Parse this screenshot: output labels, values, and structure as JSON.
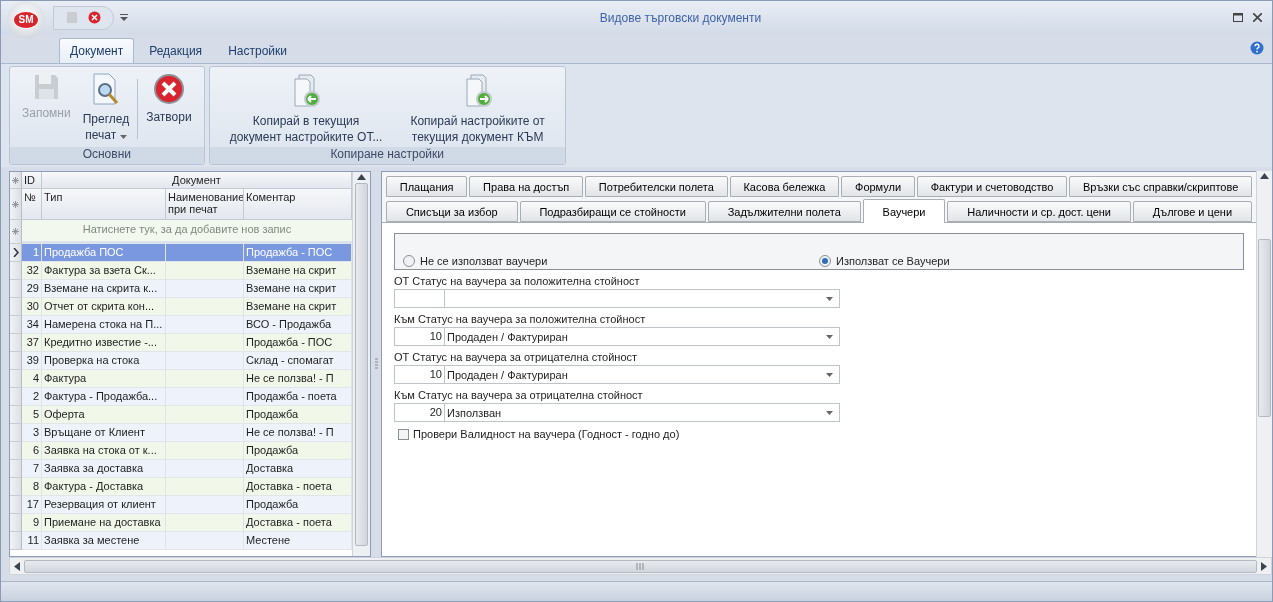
{
  "window": {
    "title": "Видове търговски документи",
    "logo": "SM"
  },
  "ribbon": {
    "tabs": [
      {
        "label": "Документ",
        "selected": true
      },
      {
        "label": "Редакция",
        "selected": false
      },
      {
        "label": "Настройки",
        "selected": false
      }
    ],
    "groups": [
      {
        "title": "Основни",
        "buttons": [
          {
            "label": "Запомни",
            "kind": "save",
            "disabled": true,
            "dropdown": false
          },
          {
            "label": "Преглед\nпечат",
            "kind": "preview",
            "disabled": false,
            "dropdown": true
          },
          {
            "label": "Затвори",
            "kind": "close",
            "disabled": false,
            "dropdown": false
          }
        ]
      },
      {
        "title": "Копиране настройки",
        "buttons": [
          {
            "label": "Копирай в текущия\nдокумент настройките ОТ...",
            "kind": "copy_in",
            "disabled": false,
            "dropdown": false
          },
          {
            "label": "Копирай настройките от\nтекущия документ КЪМ",
            "kind": "copy_out",
            "disabled": false,
            "dropdown": false
          }
        ]
      }
    ]
  },
  "grid": {
    "band": {
      "id": "ID",
      "document": "Документ"
    },
    "columns": [
      "№",
      "Тип",
      "Наименование\nпри печат",
      "Коментар"
    ],
    "new_row_hint": "Натиснете тук, за да добавите нов запис",
    "rows": [
      {
        "id": "1",
        "type": "Продажба ПОС",
        "comment": "Продажба - ПОС",
        "selected": true
      },
      {
        "id": "32",
        "type": "Фактура за взета Ск...",
        "comment": "Вземане на скрит",
        "selected": false
      },
      {
        "id": "29",
        "type": "Вземане на скрита к...",
        "comment": "Вземане на скрит",
        "selected": false
      },
      {
        "id": "30",
        "type": "Отчет от скрита кон...",
        "comment": "Вземане на скрит",
        "selected": false
      },
      {
        "id": "34",
        "type": "Намерена стока на П...",
        "comment": "ВСО - Продажба",
        "selected": false
      },
      {
        "id": "37",
        "type": "Кредитно известие -...",
        "comment": "Продажба - ПОС",
        "selected": false
      },
      {
        "id": "39",
        "type": "Проверка на стока",
        "comment": "Склад - спомагат",
        "selected": false
      },
      {
        "id": "4",
        "type": "Фактура",
        "comment": "Не се ползва! - П",
        "selected": false
      },
      {
        "id": "2",
        "type": "Фактура - Продажба...",
        "comment": "Продажба - поета",
        "selected": false
      },
      {
        "id": "5",
        "type": "Оферта",
        "comment": "Продажба",
        "selected": false
      },
      {
        "id": "3",
        "type": "Връщане от Клиент",
        "comment": "Не се ползва! - П",
        "selected": false
      },
      {
        "id": "6",
        "type": "Заявка на стока от к...",
        "comment": "Продажба",
        "selected": false
      },
      {
        "id": "7",
        "type": "Заявка за доставка",
        "comment": "Доставка",
        "selected": false
      },
      {
        "id": "8",
        "type": "Фактура - Доставка",
        "comment": "Доставка - поета",
        "selected": false
      },
      {
        "id": "17",
        "type": "Резервация от клиент",
        "comment": "Продажба",
        "selected": false
      },
      {
        "id": "9",
        "type": "Приемане на доставка",
        "comment": "Доставка - поета",
        "selected": false
      },
      {
        "id": "11",
        "type": "Заявка за местене",
        "comment": "Местене",
        "selected": false
      }
    ]
  },
  "settings_tabs": [
    [
      {
        "label": "Плащания",
        "selected": false
      },
      {
        "label": "Права на достъп",
        "selected": false
      },
      {
        "label": "Потребителски полета",
        "selected": false
      },
      {
        "label": "Касова бележка",
        "selected": false
      },
      {
        "label": "Формули",
        "selected": false
      },
      {
        "label": "Фактури и счетоводство",
        "selected": false
      },
      {
        "label": "Връзки със справки/скриптове",
        "selected": false
      }
    ],
    [
      {
        "label": "Списъци за избор",
        "selected": false
      },
      {
        "label": "Подразбиращи се стойности",
        "selected": false
      },
      {
        "label": "Задължителни полета",
        "selected": false
      },
      {
        "label": "Ваучери",
        "selected": true
      },
      {
        "label": "Наличности и ср. дост. цени",
        "selected": false
      },
      {
        "label": "Дългове и цени",
        "selected": false
      }
    ]
  ],
  "vouchers": {
    "mode_options": [
      {
        "label": "Не се използват ваучери",
        "selected": false
      },
      {
        "label": "Използват се Ваучери",
        "selected": true
      }
    ],
    "fields": [
      {
        "label": "ОТ Статус на ваучера за положителна стойност"
      },
      {
        "label": "Към Статус на ваучера за положителна стойност",
        "code": "10",
        "value": "Продаден / Фактуриран"
      },
      {
        "label": "ОТ Статус на ваучера за отрицателна стойност",
        "code": "10",
        "value": "Продаден / Фактуриран"
      },
      {
        "label": "Към Статус на ваучера за отрицателна стойност",
        "code": "20",
        "value": "Използван"
      }
    ],
    "validity_check": {
      "label": "Провери Валидност на ваучера (Годност - годно до)",
      "checked": false
    }
  }
}
